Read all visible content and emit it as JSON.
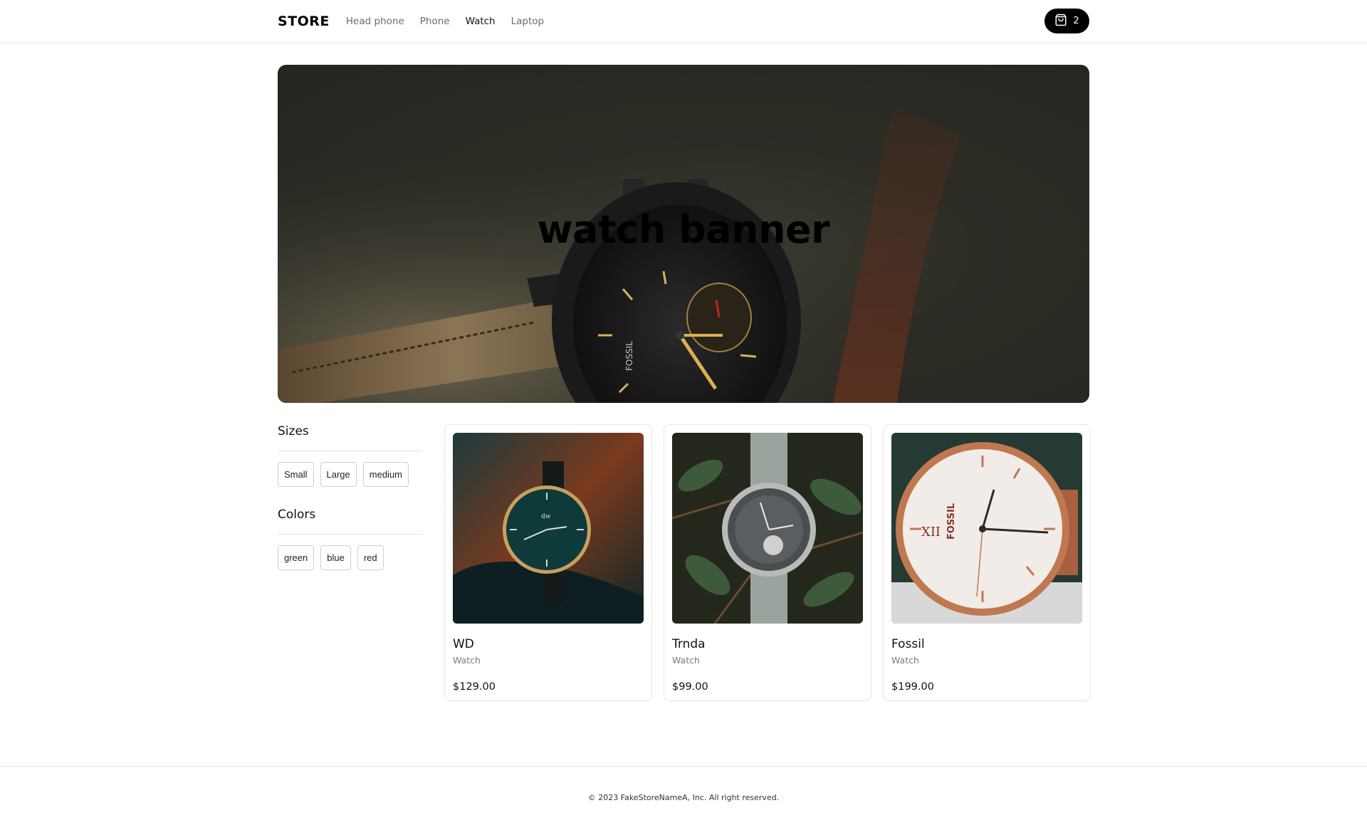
{
  "navbar": {
    "logo": "STORE",
    "links": [
      {
        "label": "Head phone",
        "active": false
      },
      {
        "label": "Phone",
        "active": false
      },
      {
        "label": "Watch",
        "active": true
      },
      {
        "label": "Laptop",
        "active": false
      }
    ],
    "cart": {
      "icon": "shopping-bag-icon",
      "count": "2"
    }
  },
  "banner": {
    "title": "watch banner"
  },
  "filters": {
    "sizes": {
      "title": "Sizes",
      "options": [
        "Small",
        "Large",
        "medium"
      ]
    },
    "colors": {
      "title": "Colors",
      "options": [
        "green",
        "blue",
        "red"
      ]
    }
  },
  "products": [
    {
      "name": "WD",
      "category": "Watch",
      "price": "$129.00"
    },
    {
      "name": "Trnda",
      "category": "Watch",
      "price": "$99.00"
    },
    {
      "name": "Fossil",
      "category": "Watch",
      "price": "$199.00"
    }
  ],
  "footer": {
    "text": "© 2023 FakeStoreNameA, Inc. All right reserved."
  },
  "colors": {
    "accent": "#000000",
    "border": "#e6e6e6",
    "muted_text": "#6b6b6b"
  }
}
